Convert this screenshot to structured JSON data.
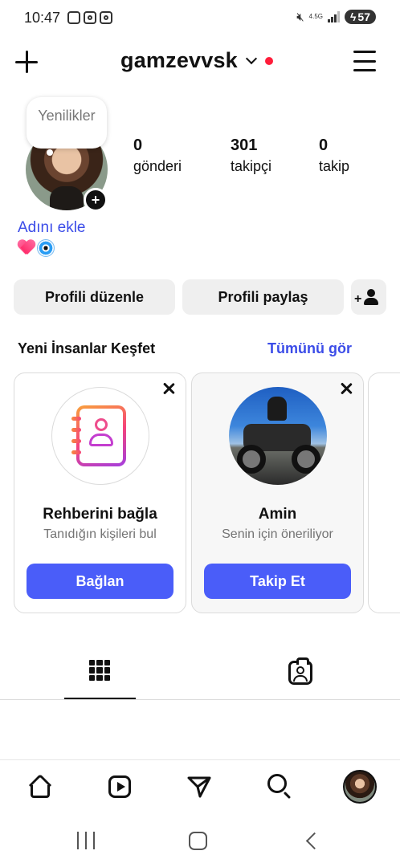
{
  "status_bar": {
    "time": "10:47",
    "network": "4.5G",
    "battery": "57"
  },
  "header": {
    "username": "gamzevvsk"
  },
  "profile": {
    "note_text": "Yenilikler",
    "name_link": "Adını ekle",
    "stats": [
      {
        "value": "0",
        "label": "gönderi"
      },
      {
        "value": "301",
        "label": "takipçi"
      },
      {
        "value": "0",
        "label": "takip"
      }
    ]
  },
  "actions": {
    "edit_profile": "Profili düzenle",
    "share_profile": "Profili paylaş"
  },
  "discover": {
    "title": "Yeni İnsanlar Keşfet",
    "see_all": "Tümünü gör",
    "cards": [
      {
        "name": "Rehberini bağla",
        "subtitle": "Tanıdığın kişileri bul",
        "button": "Bağlan"
      },
      {
        "name": "Amin",
        "subtitle": "Senin için öneriliyor",
        "button": "Takip Et"
      }
    ]
  },
  "colors": {
    "accent_blue": "#4a5df9",
    "link_blue": "#3b4ce8",
    "notification_dot": "#ff1d3a"
  }
}
